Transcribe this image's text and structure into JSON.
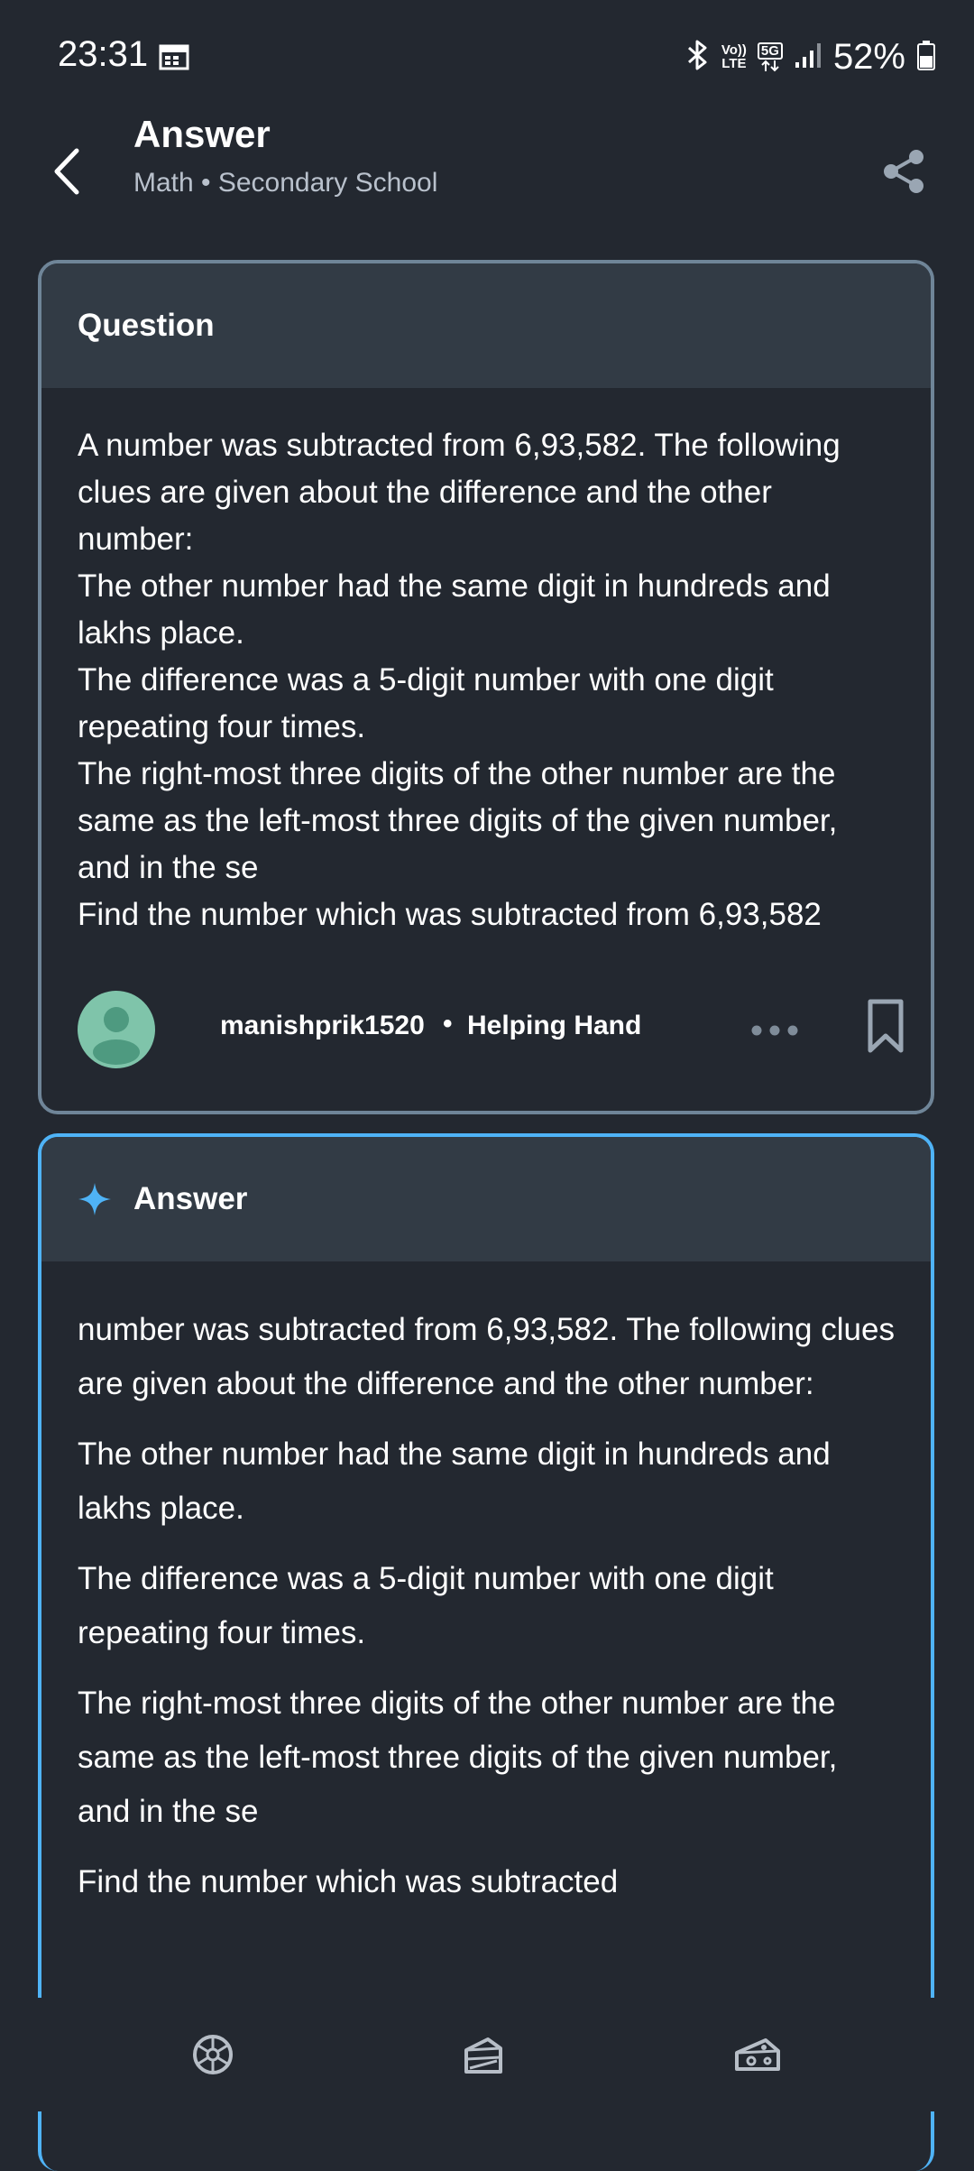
{
  "status_bar": {
    "time": "23:31",
    "icons": [
      "calendar-icon",
      "bluetooth-icon",
      "volte-icon",
      "5g-icon",
      "signal-icon",
      "battery-icon"
    ],
    "volte_top": "Vo))",
    "volte_bottom": "LTE",
    "network": "5G",
    "battery": "52%"
  },
  "header": {
    "title": "Answer",
    "subtitle": "Math • Secondary School",
    "icons": [
      "back-arrow-icon",
      "share-icon"
    ]
  },
  "question": {
    "header": "Question",
    "lines": [
      "A number was subtracted from 6,93,582. The following clues are given about the difference and the other number:",
      "The other number had the same digit in hundreds and lakhs place.",
      "The difference was a 5-digit number with one digit repeating four times.",
      "The right-most three digits of the other number are the same as the left-most three digits of the given number, and in the se",
      "Find the number which was subtracted from 6,93,582"
    ],
    "author": {
      "username": "manishprik1520",
      "separator": "•",
      "rank": "Helping Hand"
    },
    "icons": [
      "avatar-icon",
      "more-icon",
      "bookmark-icon"
    ]
  },
  "answer": {
    "header": "Answer",
    "paragraphs": [
      "number was subtracted from 6,93,582. The following clues are given about the difference and the other number:",
      "The other number had the same digit in hundreds and lakhs place.",
      "The difference was a 5-digit number with one digit repeating four times.",
      "The right-most three digits of the other number are the same as the left-most three digits of the given number, and in the se",
      "Find the number which was subtracted"
    ],
    "icons": [
      "sparkle-icon"
    ]
  },
  "bottom_nav": {
    "icons": [
      "home-icon",
      "book-icon",
      "cheese-icon"
    ]
  },
  "colors": {
    "background": "#232830",
    "card_header": "#323b45",
    "question_border": "#6f8598",
    "answer_border": "#4fb3f6",
    "avatar": "#7fc4aa"
  }
}
